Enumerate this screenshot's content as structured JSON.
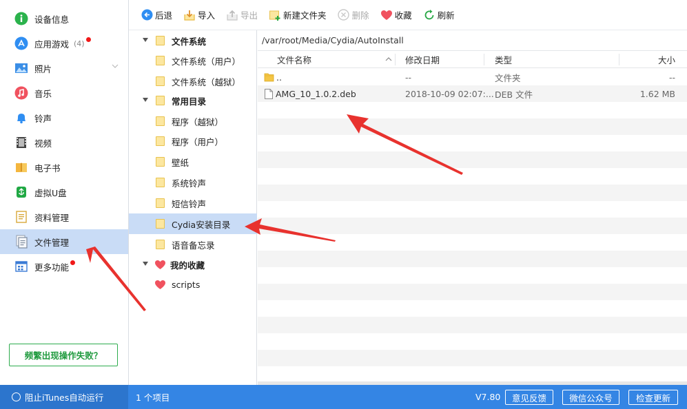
{
  "sidebar": {
    "items": [
      {
        "label": "设备信息",
        "icon": "info-icon"
      },
      {
        "label": "应用游戏",
        "icon": "app-store-icon",
        "count": "(4)",
        "dot": true
      },
      {
        "label": "照片",
        "icon": "photo-icon",
        "chevron": true
      },
      {
        "label": "音乐",
        "icon": "music-icon"
      },
      {
        "label": "铃声",
        "icon": "bell-icon"
      },
      {
        "label": "视频",
        "icon": "video-icon"
      },
      {
        "label": "电子书",
        "icon": "book-icon"
      },
      {
        "label": "虚拟U盘",
        "icon": "usb-icon"
      },
      {
        "label": "资料管理",
        "icon": "contacts-icon"
      },
      {
        "label": "文件管理",
        "icon": "file-manager-icon",
        "active": true
      },
      {
        "label": "更多功能",
        "icon": "more-features-icon",
        "dot": true
      }
    ],
    "help_button": "频繁出现操作失败？"
  },
  "toolbar": {
    "back": "后退",
    "import": "导入",
    "export": "导出",
    "new_folder": "新建文件夹",
    "delete": "删除",
    "favorite": "收藏",
    "refresh": "刷新"
  },
  "tree": {
    "filesystem": "文件系统",
    "fs_user": "文件系统（用户）",
    "fs_jailbreak": "文件系统（越狱）",
    "common": "常用目录",
    "apps_jailbreak": "程序（越狱）",
    "apps_user": "程序（用户）",
    "wallpaper": "壁纸",
    "system_ringtones": "系统铃声",
    "sms_ringtones": "短信铃声",
    "cydia_install": "Cydia安装目录",
    "voice_memos": "语音备忘录",
    "favorites": "我的收藏",
    "scripts": "scripts"
  },
  "path": "/var/root/Media/Cydia/AutoInstall",
  "columns": {
    "name": "文件名称",
    "date": "修改日期",
    "type": "类型",
    "size": "大小"
  },
  "files": [
    {
      "name": "..",
      "date": "--",
      "type": "文件夹",
      "size": "--",
      "icon": "folder-icon"
    },
    {
      "name": "AMG_10_1.0.2.deb",
      "date": "2018-10-09 02:07:...",
      "type": "DEB 文件",
      "size": "1.62 MB",
      "icon": "file-icon"
    }
  ],
  "status": {
    "itunes": "阻止iTunes自动运行",
    "items": "1 个项目",
    "version": "V7.80",
    "feedback": "意见反馈",
    "wechat": "微信公众号",
    "update": "检查更新"
  },
  "colors": {
    "accent": "#3485e4",
    "selected": "#c9dcf6",
    "arrow": "#e8322e",
    "help": "#2cab4c"
  }
}
